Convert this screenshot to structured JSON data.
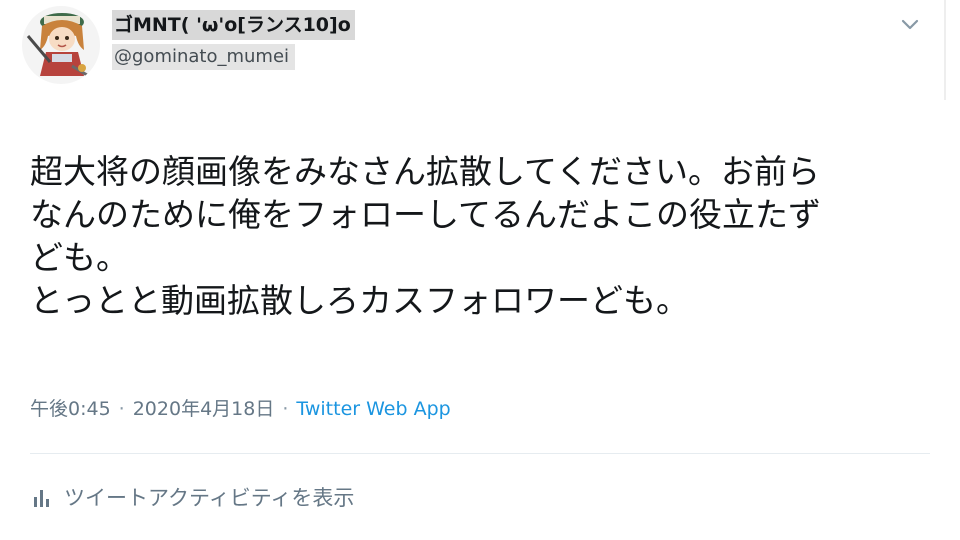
{
  "tweet": {
    "author": {
      "display_name": "ゴMNT( 'ω'o[ランス10]o",
      "handle": "@gominato_mumei",
      "avatar_icon": "anime-character-avatar-icon"
    },
    "menu_icon": "chevron-down-icon",
    "text_lines": [
      "超大将の顔画像をみなさん拡散してください。お前ら",
      "なんのために俺をフォローしてるんだよこの役立たず",
      "ども。",
      "とっとと動画拡散しろカスフォロワーども。"
    ],
    "meta": {
      "time": "午後0:45",
      "separator": "·",
      "date": "2020年4月18日",
      "source": "Twitter Web App"
    },
    "activity": {
      "icon": "bar-chart-icon",
      "label": "ツイートアクティビティを表示"
    },
    "colors": {
      "link": "#1b95e0",
      "secondary_text": "#657786",
      "primary_text": "#14171a"
    }
  }
}
